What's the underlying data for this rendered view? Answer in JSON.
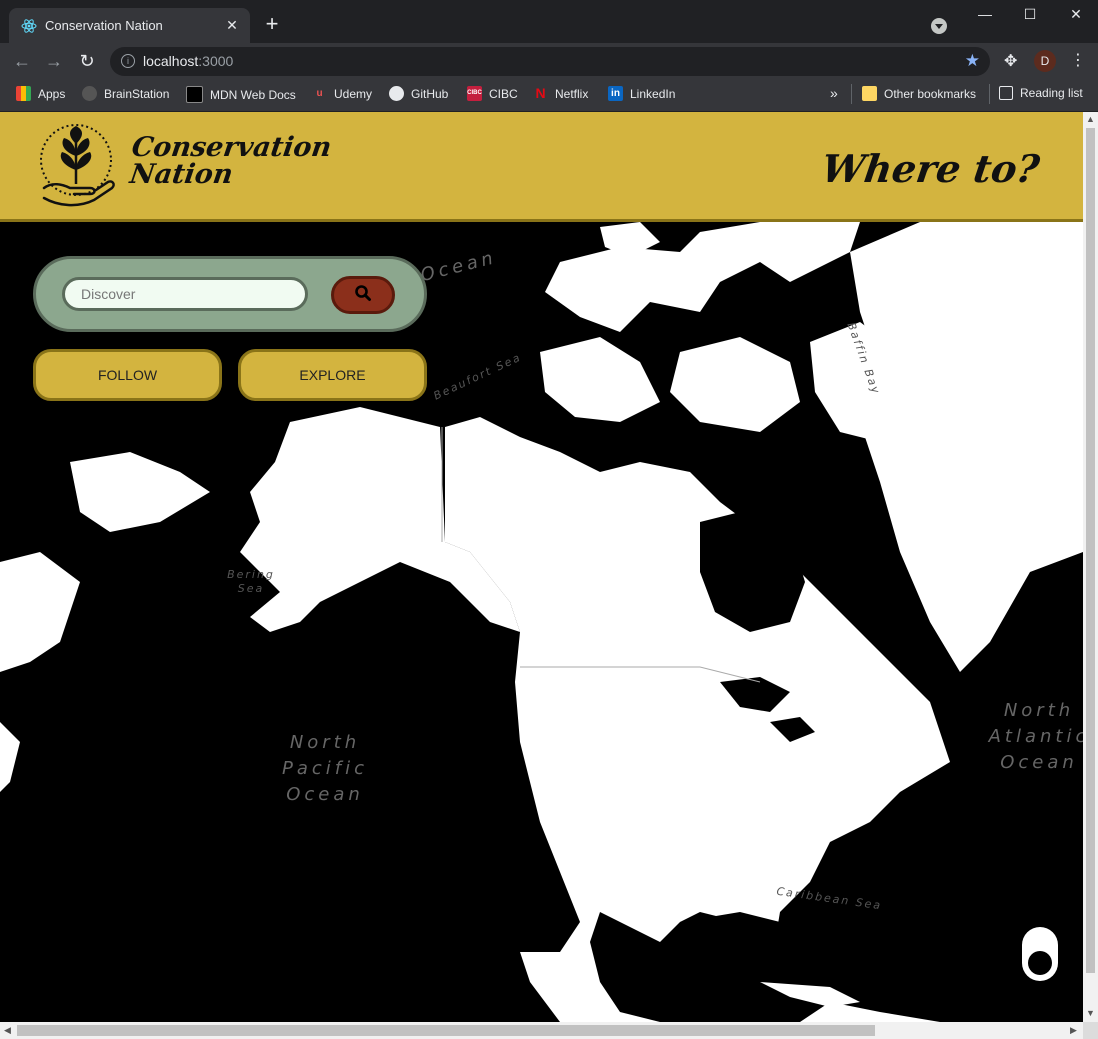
{
  "browser": {
    "tab_title": "Conservation Nation",
    "new_tab": "+",
    "tab_close": "✕",
    "url_host": "localhost",
    "url_port": ":3000",
    "profile_initial": "D",
    "window_controls": {
      "minimize": "—",
      "maximize": "☐",
      "close": "✕"
    },
    "bookmarks": [
      {
        "label": "Apps",
        "icon": "apps-grid-icon",
        "color": "#ea4335"
      },
      {
        "label": "BrainStation",
        "icon": "brainstation-icon",
        "color": "#555555"
      },
      {
        "label": "MDN Web Docs",
        "icon": "mdn-icon",
        "color": "#000000"
      },
      {
        "label": "Udemy",
        "icon": "udemy-icon",
        "color": "#ec5252"
      },
      {
        "label": "GitHub",
        "icon": "github-icon",
        "color": "#24292e"
      },
      {
        "label": "CIBC",
        "icon": "cibc-icon",
        "color": "#c41f3e"
      },
      {
        "label": "Netflix",
        "icon": "netflix-icon",
        "color": "#e50914"
      },
      {
        "label": "LinkedIn",
        "icon": "linkedin-icon",
        "color": "#0a66c2"
      }
    ],
    "bookmarks_overflow": "»",
    "other_bookmarks": "Other bookmarks",
    "reading_list": "Reading list"
  },
  "header": {
    "logo_line1": "Conservation",
    "logo_line2": "Nation",
    "tagline": "Where to?",
    "bg_color": "#d3b43f"
  },
  "search": {
    "placeholder": "Discover",
    "value": ""
  },
  "actions": {
    "follow": "FOLLOW",
    "explore": "EXPLORE"
  },
  "map_labels": {
    "arctic": "Ocean",
    "beaufort": "Beaufort Sea",
    "baffin": "Baffin Bay",
    "bering_1": "Bering",
    "bering_2": "Sea",
    "pacific_1": "North",
    "pacific_2": "Pacific",
    "pacific_3": "Ocean",
    "atlantic_1": "North",
    "atlantic_2": "Atlantic",
    "atlantic_3": "Ocean",
    "caribbean": "Caribbean Sea"
  }
}
